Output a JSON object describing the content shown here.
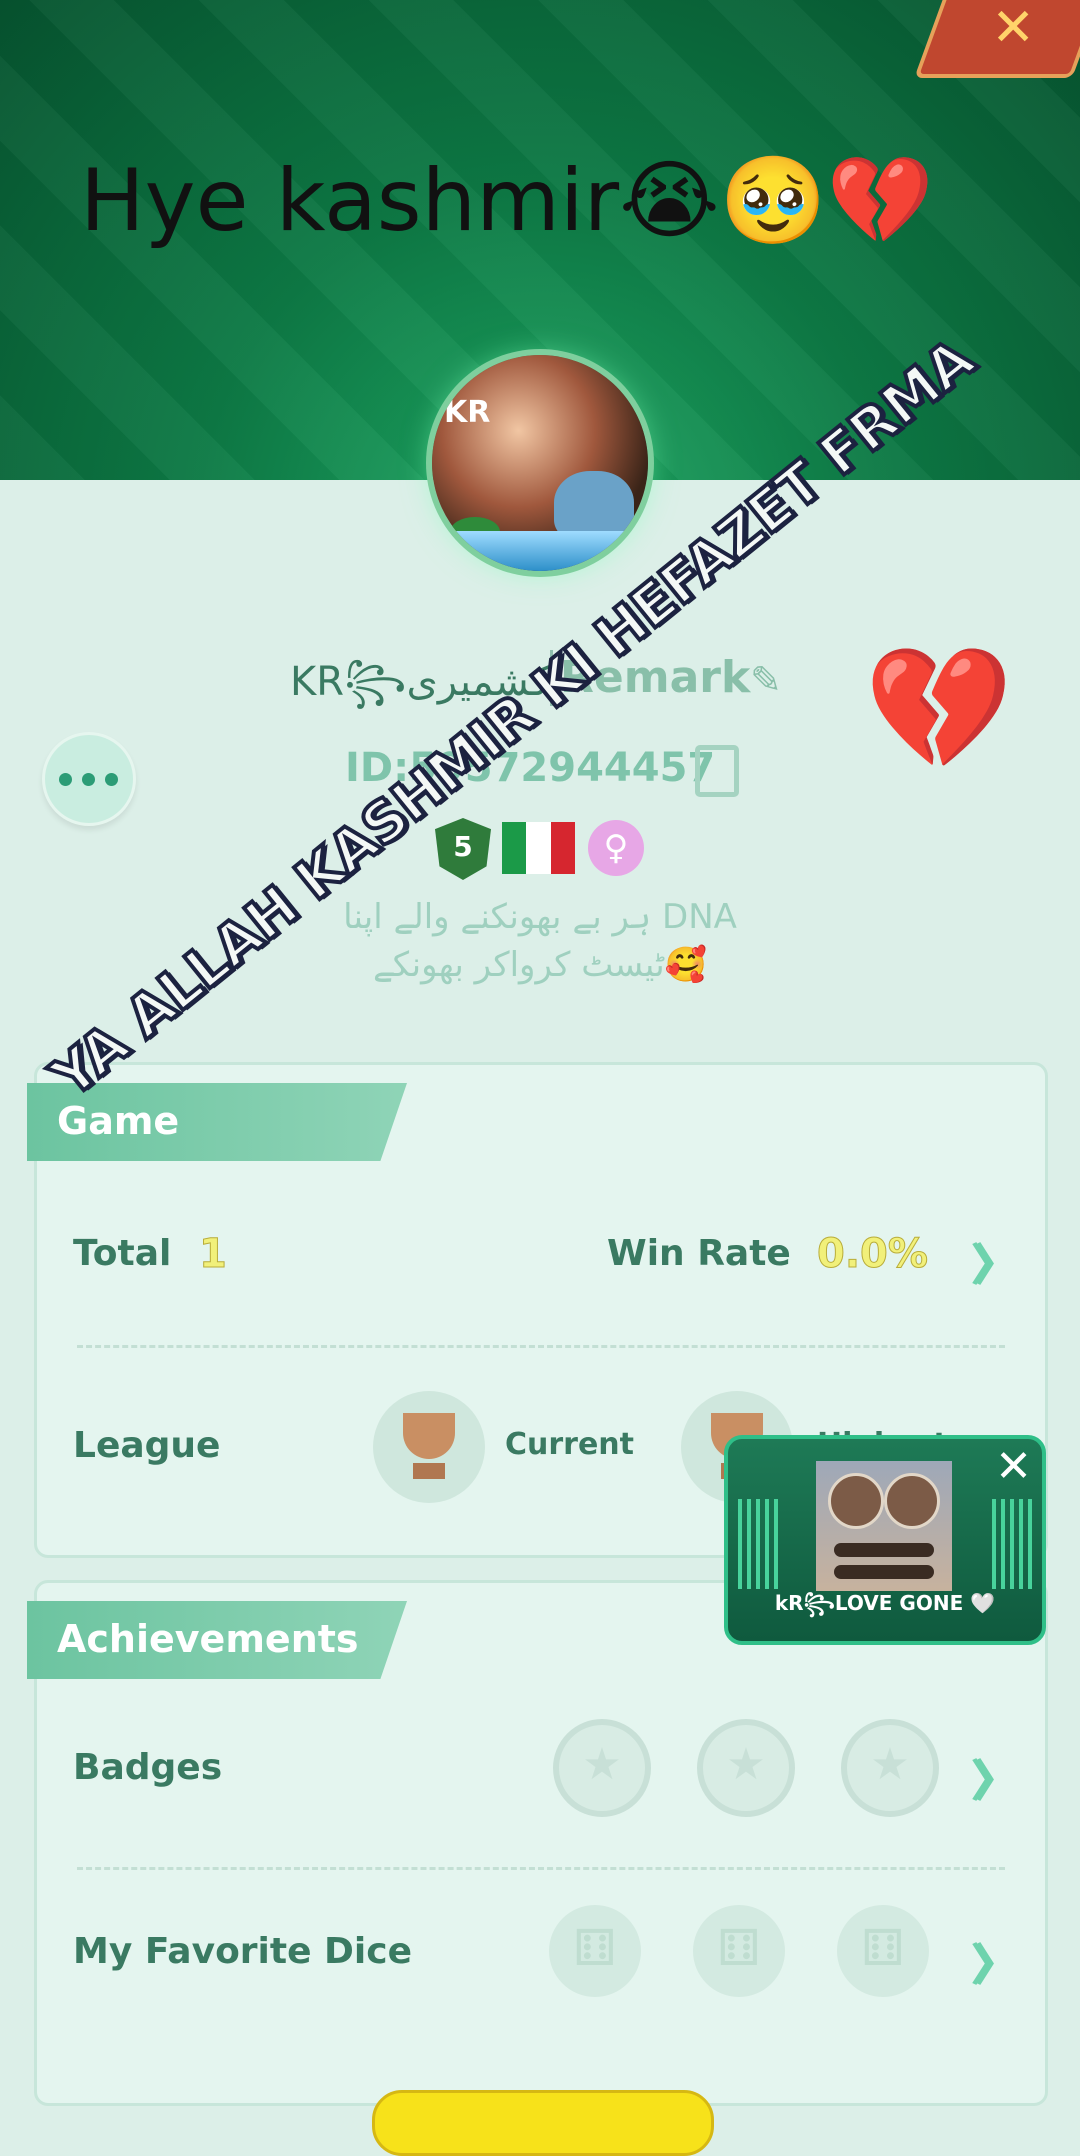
{
  "header": {
    "headline": "Hye kashmir😭🥹💔",
    "close_icon": "close-icon"
  },
  "profile": {
    "name": "KR꧂کشمیری",
    "remark_label": "Remark",
    "id_text": "ID:59572944457",
    "level": "5",
    "bio_line1": "ہر بے بھونکنے والے اپنا DNA",
    "bio_line2": "ٹیسٹ کرواکر بھونکے🥰"
  },
  "game": {
    "title": "Game",
    "total_label": "Total",
    "total_value": "1",
    "win_rate_label": "Win Rate",
    "win_rate_value": "0.0%",
    "win_rate_fraction": 0.0,
    "league_label": "League",
    "current_label": "Current",
    "highest_label": "Highest"
  },
  "achievements": {
    "title": "Achievements",
    "badges_label": "Badges",
    "dice_label": "My Favorite Dice"
  },
  "overlay": {
    "text": "YA ALLAH KASHMIR KI HEFAZET FRMA",
    "heart": "💔"
  },
  "mini_player": {
    "caption": "kR꧂LOVE GONE 🤍",
    "close_glyph": "✕"
  },
  "colors": {
    "accent": "#2c9c76",
    "header_green": "#0d7a45",
    "card_bg": "#e4f5ef",
    "value_yellow": "#f1f07a"
  }
}
